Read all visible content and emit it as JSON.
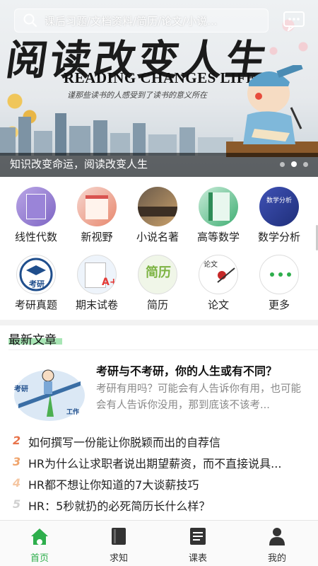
{
  "search": {
    "placeholder": "课后习题/文档资料/简历/论文/小说..."
  },
  "banner": {
    "title_cn": "阅读改变人生",
    "title_en": "READING CHANGES LIFE",
    "subtitle": "谨那些读书的人感受到了读书的意义所在",
    "caption": "知识改变命运，阅读改变人生",
    "slides": 3,
    "active_slide": 2
  },
  "categories": [
    {
      "label": "线性代数",
      "icon": "linear-algebra-icon"
    },
    {
      "label": "新视野",
      "icon": "new-horizon-icon"
    },
    {
      "label": "小说名著",
      "icon": "novel-icon"
    },
    {
      "label": "高等数学",
      "icon": "advanced-math-icon"
    },
    {
      "label": "数学分析",
      "icon": "math-analysis-icon"
    },
    {
      "label": "考研真题",
      "icon": "kaoyan-icon"
    },
    {
      "label": "期末试卷",
      "icon": "final-exam-icon"
    },
    {
      "label": "简历",
      "icon": "resume-icon"
    },
    {
      "label": "论文",
      "icon": "thesis-icon"
    },
    {
      "label": "更多",
      "icon": "more-icon"
    }
  ],
  "category_badges": {
    "kaoyan": "考研",
    "resume": "简历",
    "thesis": "论文",
    "math": "数学分析"
  },
  "section": {
    "title": "最新文章"
  },
  "featured": {
    "title": "考研与不考研，你的人生或有不同？",
    "summary": "考研有用吗？可能会有人告诉你有用，也可能会有人告诉你没用，那到底该不该考...",
    "thumb_left": "考研",
    "thumb_right": "工作"
  },
  "articles": [
    {
      "num": "2",
      "text": "如何撰写一份能让你脱颖而出的自荐信",
      "color": "#e8734a"
    },
    {
      "num": "3",
      "text": "HR为什么让求职者说出期望薪资，而不直接说具...",
      "color": "#f0a46c"
    },
    {
      "num": "4",
      "text": "HR都不想让你知道的7大谈薪技巧",
      "color": "#f5c7a3"
    },
    {
      "num": "5",
      "text": "HR：5秒就扔的必死简历长什么样？",
      "color": "#d0d0d0"
    }
  ],
  "tabs": [
    {
      "label": "首页",
      "icon": "home-icon",
      "active": true
    },
    {
      "label": "求知",
      "icon": "book-icon",
      "active": false
    },
    {
      "label": "课表",
      "icon": "schedule-icon",
      "active": false
    },
    {
      "label": "我的",
      "icon": "profile-icon",
      "active": false
    }
  ],
  "colors": {
    "accent": "#2eae4c",
    "highlight": "#a8e6b5"
  }
}
